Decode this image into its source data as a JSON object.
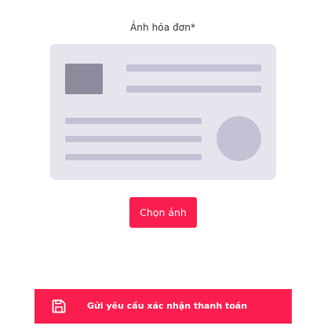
{
  "invoice_field": {
    "label": "Ảnh hóa đơn*",
    "placeholder_icon": "id-card-placeholder-icon"
  },
  "choose_button": {
    "label": "Chọn ảnh"
  },
  "submit_button": {
    "label": "Gửi yêu cầu xác nhận thanh toán",
    "icon": "save-icon"
  },
  "colors": {
    "accent": "#fa1e4e",
    "placeholder_bg": "#e6e5ed",
    "placeholder_shape": "#c5c1d4",
    "placeholder_photo": "#8e8a9d"
  }
}
